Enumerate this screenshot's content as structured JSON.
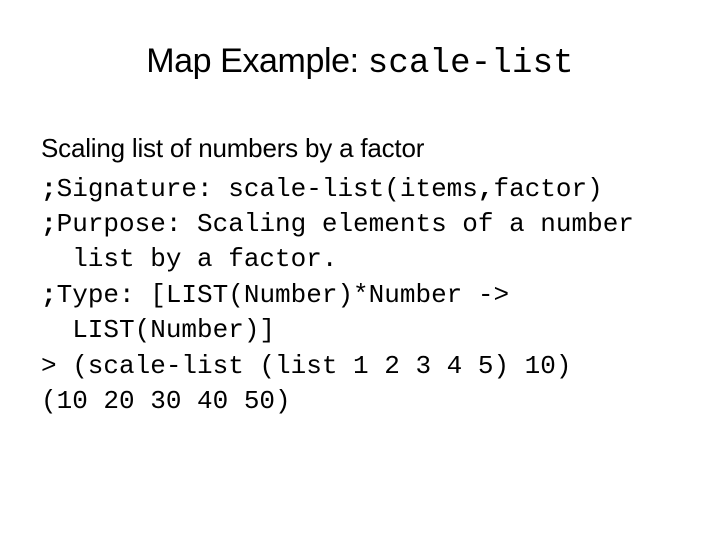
{
  "slide": {
    "background_color": "#ffffff",
    "text_color": "#000000",
    "title": {
      "prose": "Map Example: ",
      "code": "scale-list"
    },
    "subtitle": "Scaling list of numbers by a factor",
    "code_lines": [
      {
        "id": "signature",
        "segments": [
          {
            "text": ";",
            "bold": true
          },
          {
            "text": "Signature: scale-list(items",
            "bold": false
          },
          {
            "text": ",",
            "bold": true
          },
          {
            "text": "factor)",
            "bold": false
          }
        ]
      },
      {
        "id": "purpose",
        "segments": [
          {
            "text": ";",
            "bold": true
          },
          {
            "text": "Purpose: Scaling elements of a number",
            "bold": false
          }
        ]
      },
      {
        "id": "purpose-cont",
        "segments": [
          {
            "text": "  list by a factor.",
            "bold": false
          }
        ]
      },
      {
        "id": "type",
        "segments": [
          {
            "text": ";",
            "bold": true
          },
          {
            "text": "Type: [LIST(Number)*Number ->",
            "bold": false
          }
        ]
      },
      {
        "id": "type-cont",
        "segments": [
          {
            "text": "  LIST(Number)]",
            "bold": false
          }
        ]
      },
      {
        "id": "repl-input",
        "segments": [
          {
            "text": "> (scale-list (list 1 2 3 4 5) 10)",
            "bold": false
          }
        ]
      },
      {
        "id": "repl-output",
        "segments": [
          {
            "text": "(10 20 30 40 50)",
            "bold": false
          }
        ]
      }
    ]
  }
}
